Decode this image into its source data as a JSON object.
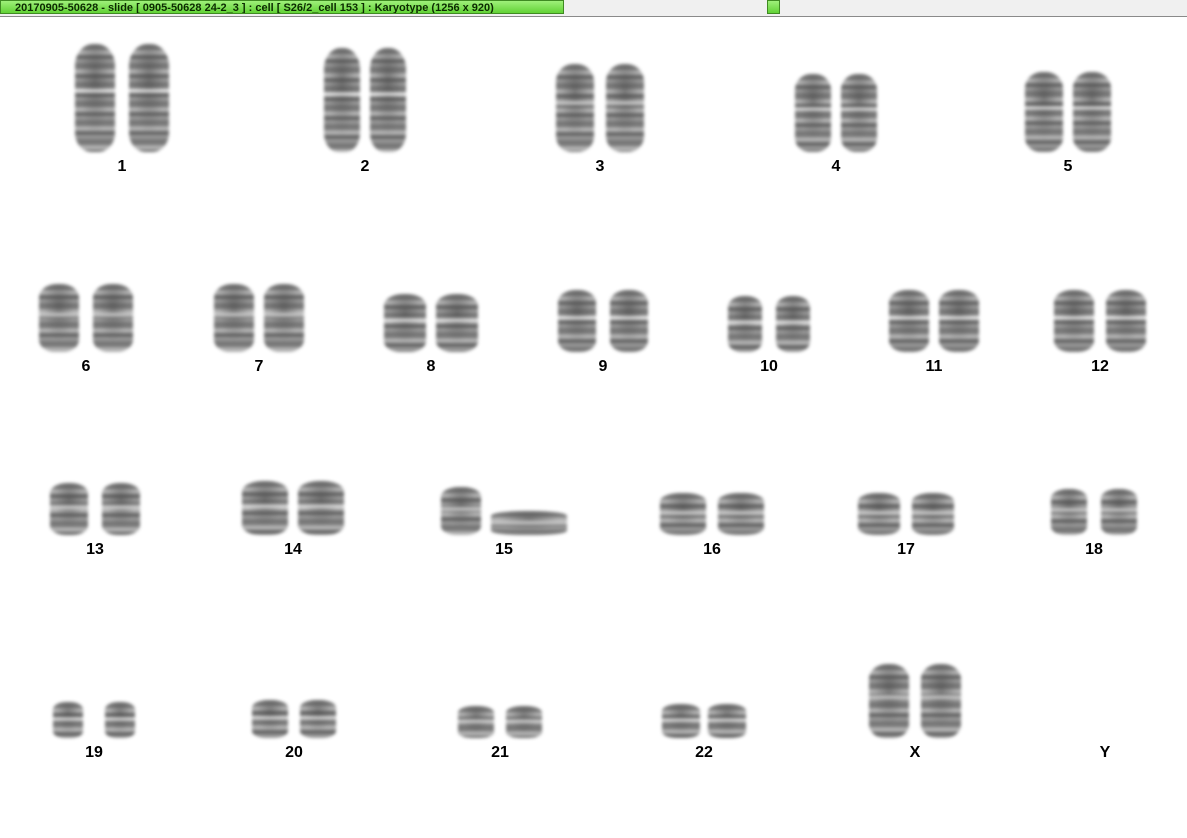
{
  "window": {
    "title": "20170905-50628 - slide [ 0905-50628 24-2_3 ] : cell [ S26/2_cell 153 ] : Karyotype  (1256 x 920)"
  },
  "karyogram": {
    "chromosomes": [
      {
        "label": "1",
        "copies": 2
      },
      {
        "label": "2",
        "copies": 2
      },
      {
        "label": "3",
        "copies": 2
      },
      {
        "label": "4",
        "copies": 2
      },
      {
        "label": "5",
        "copies": 2
      },
      {
        "label": "6",
        "copies": 2
      },
      {
        "label": "7",
        "copies": 2
      },
      {
        "label": "8",
        "copies": 2
      },
      {
        "label": "9",
        "copies": 2
      },
      {
        "label": "10",
        "copies": 2
      },
      {
        "label": "11",
        "copies": 2
      },
      {
        "label": "12",
        "copies": 2
      },
      {
        "label": "13",
        "copies": 2
      },
      {
        "label": "14",
        "copies": 2
      },
      {
        "label": "15",
        "copies": 2
      },
      {
        "label": "16",
        "copies": 2
      },
      {
        "label": "17",
        "copies": 2
      },
      {
        "label": "18",
        "copies": 2
      },
      {
        "label": "19",
        "copies": 2
      },
      {
        "label": "20",
        "copies": 2
      },
      {
        "label": "21",
        "copies": 2
      },
      {
        "label": "22",
        "copies": 2
      },
      {
        "label": "X",
        "copies": 2
      },
      {
        "label": "Y",
        "copies": 0
      }
    ]
  }
}
